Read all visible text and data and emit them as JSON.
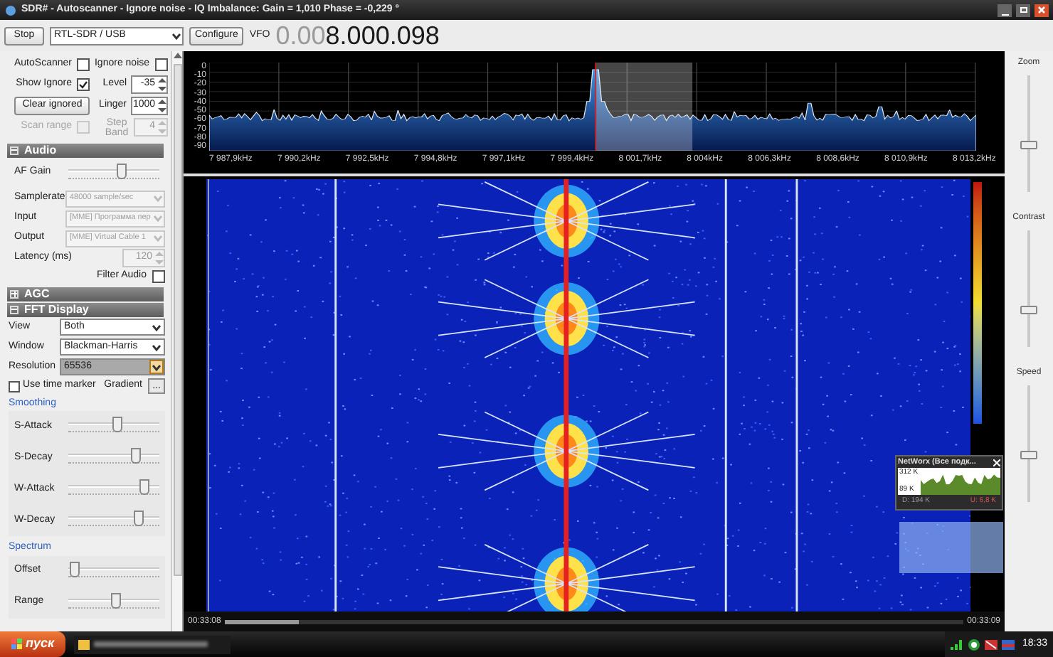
{
  "window": {
    "title": "SDR# - Autoscanner - Ignore noise - IQ Imbalance: Gain = 1,010 Phase = -0,229 °"
  },
  "toolbar": {
    "stop": "Stop",
    "device": "RTL-SDR / USB",
    "configure": "Configure",
    "vfo_label": "VFO",
    "frequency_dim": "0.00",
    "frequency": "8.000.098"
  },
  "scanner": {
    "autoscanner": {
      "label": "AutoScanner",
      "checked": false
    },
    "ignore_noise": {
      "label": "Ignore noise",
      "checked": false
    },
    "show_ignore": {
      "label": "Show Ignore",
      "checked": true
    },
    "level": {
      "label": "Level",
      "value": "-35"
    },
    "clear": "Clear ignored",
    "linger": {
      "label": "Linger",
      "value": "1000"
    },
    "scan_range": {
      "label": "Scan range",
      "checked": false,
      "disabled": true
    },
    "step_band": {
      "label": "Step Band",
      "value": "4",
      "disabled": true
    }
  },
  "audio": {
    "title": "Audio",
    "expanded": true,
    "af_gain": {
      "label": "AF Gain",
      "level": 0.6
    },
    "rows": [
      {
        "kind": "select",
        "label": "Samplerate",
        "value": "48000 sample/sec",
        "disabled": true
      },
      {
        "kind": "select",
        "label": "Input",
        "value": "[MME] Программа пер",
        "disabled": true
      },
      {
        "kind": "select",
        "label": "Output",
        "value": "[MME] Virtual Cable 1",
        "disabled": true
      },
      {
        "kind": "spin",
        "label": "Latency (ms)",
        "value": "120",
        "disabled": true
      }
    ],
    "filter_audio": {
      "label": "Filter Audio",
      "checked": false
    }
  },
  "agc": {
    "title": "AGC",
    "expanded": false
  },
  "fft": {
    "title": "FFT Display",
    "expanded": true,
    "rows": [
      {
        "label": "View",
        "value": "Both",
        "selected": false
      },
      {
        "label": "Window",
        "value": "Blackman-Harris",
        "selected": false
      },
      {
        "label": "Resolution",
        "value": "65536",
        "selected": true
      }
    ],
    "time_marker": {
      "label": "Use time marker",
      "checked": false
    },
    "gradient": {
      "label": "Gradient",
      "button": "..."
    },
    "smoothing": {
      "title": "Smoothing",
      "sliders": [
        {
          "label": "S-Attack",
          "level": 0.55
        },
        {
          "label": "S-Decay",
          "level": 0.78
        },
        {
          "label": "W-Attack",
          "level": 0.88
        },
        {
          "label": "W-Decay",
          "level": 0.8
        }
      ]
    },
    "spectrum": {
      "title": "Spectrum",
      "sliders": [
        {
          "label": "Offset",
          "level": 0.02
        },
        {
          "label": "Range",
          "level": 0.53
        }
      ]
    }
  },
  "spectrum": {
    "y_labels": [
      "0",
      "-10",
      "-20",
      "-30",
      "-40",
      "-50",
      "-60",
      "-70",
      "-80",
      "-90"
    ],
    "x_labels": [
      "7 987,9kHz",
      "7 990,2kHz",
      "7 992,5kHz",
      "7 994,8kHz",
      "7 997,1kHz",
      "7 999,4kHz",
      "8 001,7kHz",
      "8 004kHz",
      "8 006,3kHz",
      "8 008,6kHz",
      "8 010,9kHz",
      "8 013,2kHz"
    ]
  },
  "right_panel": {
    "sliders": [
      {
        "label": "Zoom",
        "level": 0.4
      },
      {
        "label": "Contrast",
        "level": 0.3
      },
      {
        "label": "Speed",
        "level": 0.4
      }
    ]
  },
  "media_bar": {
    "elapsed": "00:33:08",
    "total": "00:33:09",
    "level": 0.1
  },
  "networx": {
    "title": "NetWorx (Все подк...",
    "high": "312 K",
    "low": "89 K",
    "download": "D: 194 K",
    "upload": "U: 6,8 K"
  },
  "taskbar": {
    "start": "пуск",
    "clock": "18:33"
  }
}
